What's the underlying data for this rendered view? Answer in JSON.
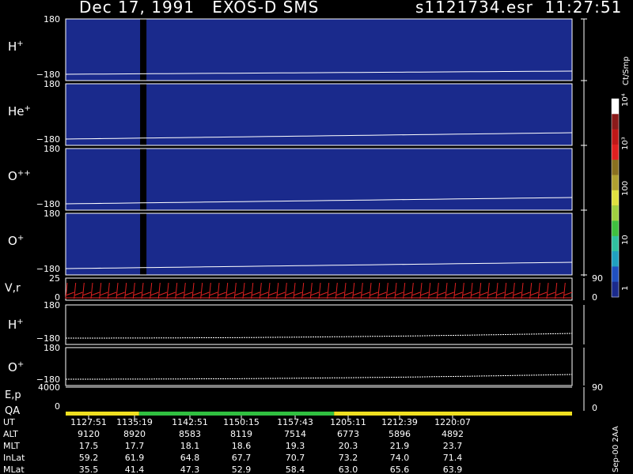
{
  "header": {
    "title_left": "Dec 17, 1991   EXOS-D SMS",
    "title_right": "s1121734.esr  11:27:51"
  },
  "colors": {
    "background": "#000000",
    "panel_bg": "#1a2a8c",
    "trace": "#ffffff",
    "vr_trace": "#e02020",
    "qa_yellow": "#f0e020",
    "qa_green": "#30c040"
  },
  "chart_data": {
    "type": "heatmap",
    "panels": [
      {
        "name": "H+",
        "label_base": "H",
        "label_sup": "+",
        "ytop": "180",
        "ybot": "−180"
      },
      {
        "name": "He+",
        "label_base": "He",
        "label_sup": "+",
        "ytop": "180",
        "ybot": "−180"
      },
      {
        "name": "O++",
        "label_base": "O",
        "label_sup": "++",
        "ytop": "180",
        "ybot": "−180"
      },
      {
        "name": "O+",
        "label_base": "O",
        "label_sup": "+",
        "ytop": "180",
        "ybot": "−180"
      }
    ],
    "line_panels": [
      {
        "name": "V,r",
        "label": "V,r",
        "ytop": "25",
        "ybot": "0",
        "right_top": "90",
        "right_bot": "0"
      },
      {
        "name": "H+",
        "label_base": "H",
        "label_sup": "+",
        "ytop": "180",
        "ybot": "−180"
      },
      {
        "name": "O+",
        "label_base": "O",
        "label_sup": "+",
        "ytop": "180",
        "ybot": "−180"
      },
      {
        "name": "E,p",
        "label": "E,p",
        "ytop": "4000",
        "right_top": "90"
      },
      {
        "name": "QA",
        "label": "QA",
        "ybot": "0",
        "right_bot": "0"
      }
    ],
    "colorbar": {
      "unit": "Ct/Smp",
      "ticks": [
        "10⁴",
        "10³",
        "100",
        "10",
        "1"
      ]
    },
    "qa_segments": [
      {
        "start": 0,
        "end": 0.145,
        "color": "#f0e020"
      },
      {
        "start": 0.145,
        "end": 0.53,
        "color": "#30c040"
      },
      {
        "start": 0.53,
        "end": 1.0,
        "color": "#f0e020"
      }
    ],
    "axis_table": {
      "rows": [
        {
          "label": "UT",
          "values": [
            "1127:51",
            "1135:19",
            "1142:51",
            "1150:15",
            "1157:43",
            "1205:11",
            "1212:39",
            "1220:07"
          ]
        },
        {
          "label": "ALT",
          "values": [
            "9120",
            "8920",
            "8583",
            "8119",
            "7514",
            "6773",
            "5896",
            "4892"
          ]
        },
        {
          "label": "MLT",
          "values": [
            "17.5",
            "17.7",
            "18.1",
            "18.6",
            "19.3",
            "20.3",
            "21.9",
            "23.7"
          ]
        },
        {
          "label": "InLat",
          "values": [
            "59.2",
            "61.9",
            "64.8",
            "67.7",
            "70.7",
            "73.2",
            "74.0",
            "71.4"
          ]
        },
        {
          "label": "MLat",
          "values": [
            "35.5",
            "41.4",
            "47.3",
            "52.9",
            "58.4",
            "63.0",
            "65.6",
            "63.9"
          ]
        }
      ]
    },
    "footer_note": "Sep-00 2AA"
  }
}
